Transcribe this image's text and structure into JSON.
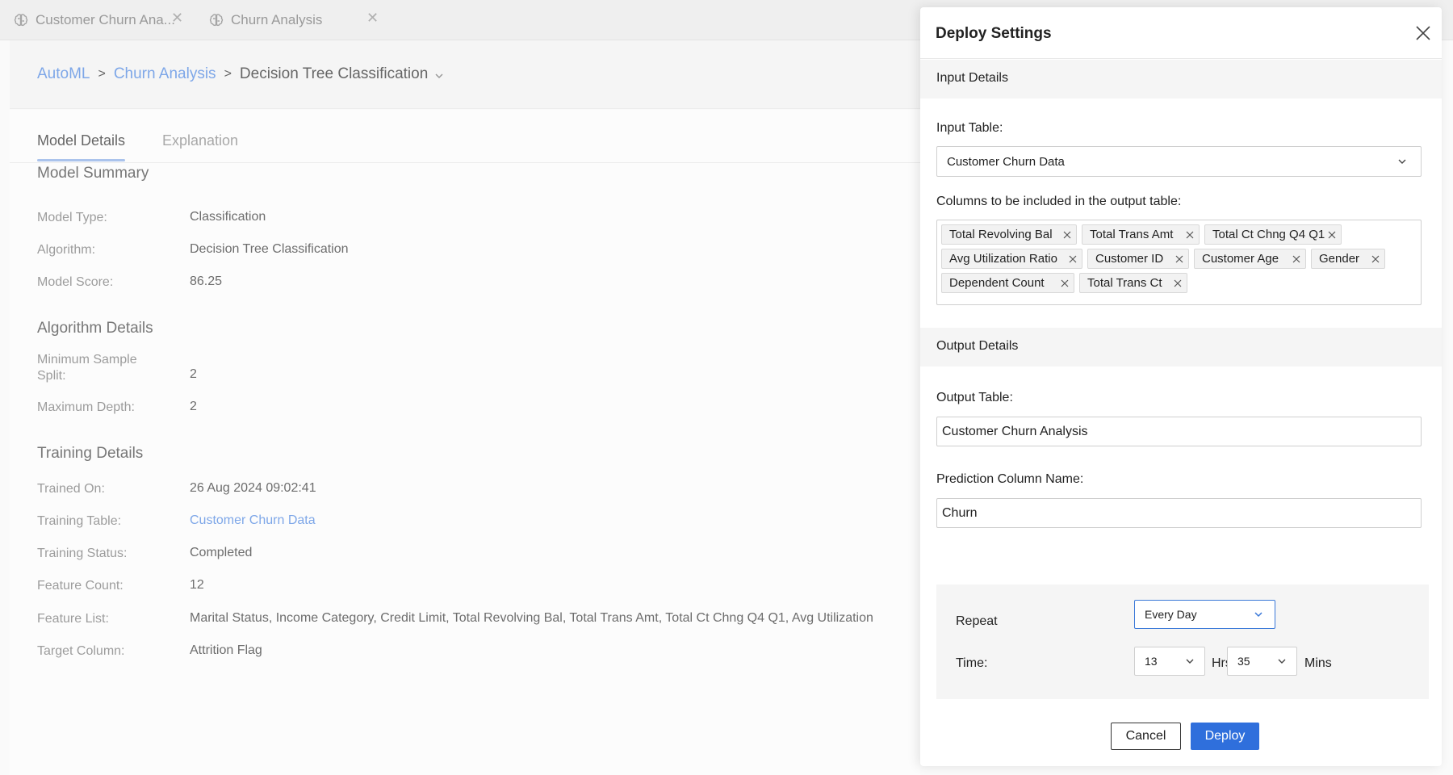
{
  "tabs": [
    {
      "label": "Customer Churn Ana...",
      "icon": "brain-icon"
    },
    {
      "label": "Churn Analysis",
      "icon": "brain-icon"
    }
  ],
  "breadcrumb": {
    "root": "AutoML",
    "parent": "Churn Analysis",
    "current": "Decision Tree Classification"
  },
  "model_tabs": {
    "details": "Model Details",
    "explanation": "Explanation"
  },
  "model_summary": {
    "title": "Model Summary",
    "rows": [
      {
        "label": "Model Type:",
        "value": "Classification"
      },
      {
        "label": "Algorithm:",
        "value": "Decision Tree Classification"
      },
      {
        "label": "Model Score:",
        "value": "86.25"
      }
    ]
  },
  "algorithm_details": {
    "title": "Algorithm Details",
    "rows": [
      {
        "label": "Minimum Sample Split:",
        "value": "2"
      },
      {
        "label": "Maximum Depth:",
        "value": "2"
      }
    ]
  },
  "training_details": {
    "title": "Training Details",
    "rows": [
      {
        "label": "Trained On:",
        "value": "26 Aug 2024 09:02:41"
      },
      {
        "label": "Training Table:",
        "value": "Customer Churn Data"
      },
      {
        "label": "Training Status:",
        "value": "Completed"
      },
      {
        "label": "Feature Count:",
        "value": "12"
      },
      {
        "label": "Feature List:",
        "value": "Marital Status, Income Category, Credit Limit, Total Revolving Bal, Total Trans Amt, Total Ct Chng Q4 Q1, Avg Utilization"
      },
      {
        "label": "Target Column:",
        "value": "Attrition Flag"
      }
    ]
  },
  "modal": {
    "title": "Deploy Settings",
    "input_section": "Input Details",
    "input_table_label": "Input Table:",
    "input_table_value": "Customer Churn Data",
    "columns_label": "Columns to be included in the output table:",
    "columns": [
      "Total Revolving Bal",
      "Total Trans Amt",
      "Total Ct Chng Q4 Q1",
      "Avg Utilization Ratio",
      "Customer ID",
      "Customer Age",
      "Gender",
      "Dependent Count",
      "Total Trans Ct"
    ],
    "output_section": "Output Details",
    "output_table_label": "Output Table:",
    "output_table_value": "Customer Churn Analysis",
    "prediction_label": "Prediction Column Name:",
    "prediction_value": "Churn",
    "repeat_label": "Repeat",
    "repeat_value": "Every Day",
    "time_label": "Time:",
    "hours_value": "13",
    "hours_unit": "Hrs",
    "minutes_value": "35",
    "minutes_unit": "Mins",
    "cancel_label": "Cancel",
    "deploy_label": "Deploy",
    "accent_color": "#2f6fdc",
    "link_color": "#7ea7e8"
  }
}
